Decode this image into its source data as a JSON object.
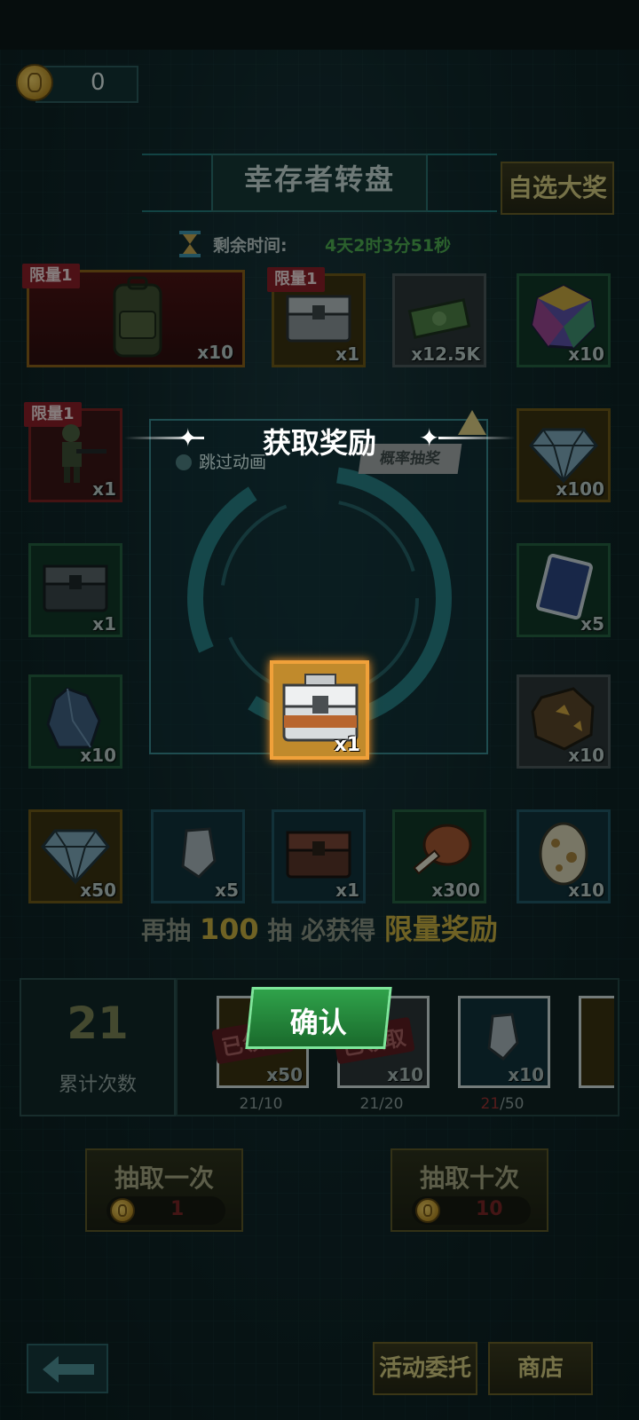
{
  "currency": {
    "coins": "0"
  },
  "title": "幸存者转盘",
  "choose_grand_prize": "自选大奖",
  "timer": {
    "label": "剩余时间:",
    "value": "4天2时3分51秒"
  },
  "limit_tag": "限量1",
  "rewards": [
    {
      "qty": "x10",
      "icon": "backpack-icon",
      "limited": true
    },
    {
      "qty": "x1",
      "icon": "chest-icon",
      "limited": true
    },
    {
      "qty": "x12.5K",
      "icon": "cash-icon",
      "limited": false
    },
    {
      "qty": "x10",
      "icon": "rainbow-gem-icon",
      "limited": false
    },
    {
      "qty": "x1",
      "icon": "soldier-icon",
      "limited": true
    },
    {
      "qty": "x100",
      "icon": "diamond-icon",
      "limited": false
    },
    {
      "qty": "x1",
      "icon": "chest-icon",
      "limited": false
    },
    {
      "qty": "x5",
      "icon": "card-icon",
      "limited": false
    },
    {
      "qty": "x10",
      "icon": "crystal-icon",
      "limited": false
    },
    {
      "qty": "x10",
      "icon": "ore-icon",
      "limited": false
    },
    {
      "qty": "x50",
      "icon": "diamond-icon",
      "limited": false
    },
    {
      "qty": "x5",
      "icon": "stone-icon",
      "limited": false
    },
    {
      "qty": "x1",
      "icon": "chest-icon",
      "limited": false
    },
    {
      "qty": "x300",
      "icon": "meat-icon",
      "limited": false
    },
    {
      "qty": "x10",
      "icon": "egg-icon",
      "limited": false
    }
  ],
  "promo": {
    "prefix": "再抽",
    "count": "100",
    "mid": "抽 必获得",
    "reward": "限量奖励"
  },
  "counter": {
    "value": "21",
    "label": "累计次数"
  },
  "milestones": [
    {
      "qty": "x50",
      "progress_done": "21",
      "progress_target": "/10",
      "stamp": "已领取"
    },
    {
      "qty": "x10",
      "progress_done": "21",
      "progress_target": "/20",
      "stamp": "已领取"
    },
    {
      "qty": "x10",
      "progress_done": "21",
      "progress_target": "/50",
      "stamp": ""
    }
  ],
  "draw_once": {
    "label": "抽取一次",
    "cost": "1"
  },
  "draw_ten": {
    "label": "抽取十次",
    "cost": "10"
  },
  "footer": {
    "activity": "活动委托",
    "shop": "商店"
  },
  "modal": {
    "title": "获取奖励",
    "skip_animation": "跳过动画",
    "probability_tab": "概率抽奖",
    "reward_qty": "x1",
    "confirm": "确认"
  },
  "colors": {
    "accent_green": "#4ea84a",
    "gold": "#c8a93a",
    "limit_red": "#8a1620"
  }
}
